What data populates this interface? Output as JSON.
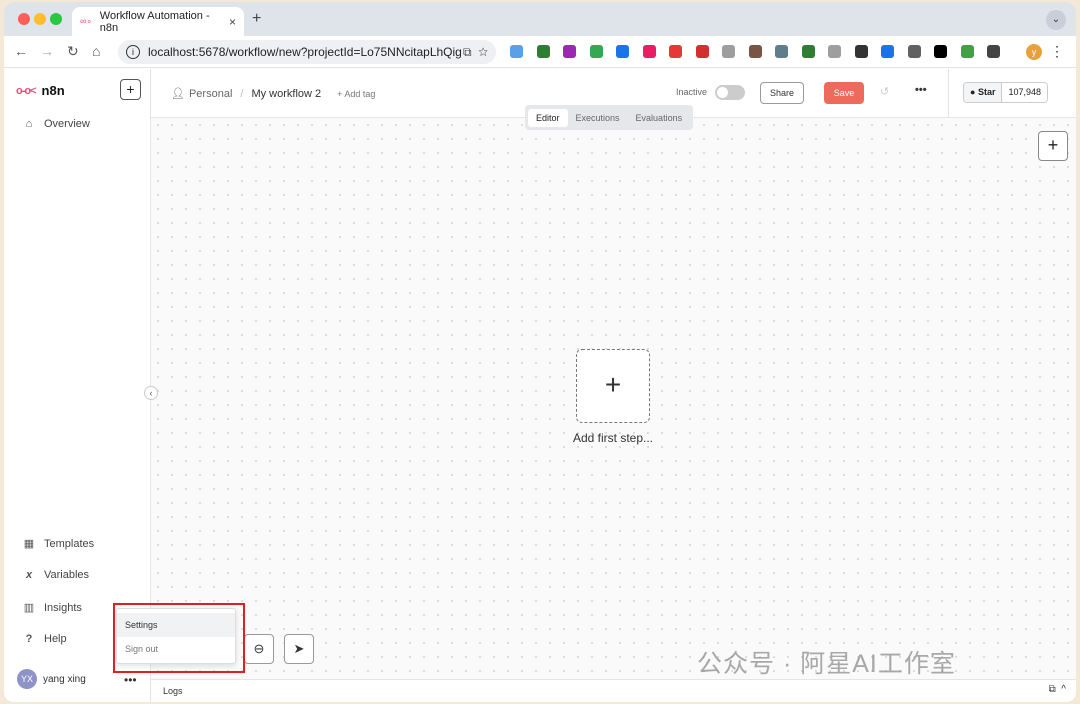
{
  "browser": {
    "tab_title": "Workflow Automation - n8n",
    "tab_close": "×",
    "new_tab": "+",
    "url": "localhost:5678/workflow/new?projectId=Lo75NNcitapLhQig",
    "profile_initial": "y",
    "extension_colors": [
      "#5aa0e8",
      "#2e7d32",
      "#9c27b0",
      "#34a853",
      "#1a73e8",
      "#e91e63",
      "#e53935",
      "#d32f2f",
      "#9e9e9e",
      "#795548",
      "#607d8b",
      "#2e7d32",
      "#9e9e9e",
      "#333333",
      "#1a73e8",
      "#616161",
      "#000000",
      "#43a047",
      "#444444"
    ]
  },
  "sidebar": {
    "logo_text": "n8n",
    "add_label": "+",
    "overview": "Overview",
    "templates": "Templates",
    "variables": "Variables",
    "insights": "Insights",
    "help": "Help",
    "collapse_glyph": "‹",
    "user_initials": "YX",
    "user_name": "yang xing",
    "more": "•••"
  },
  "header": {
    "project": "Personal",
    "separator": "/",
    "workflow_name": "My workflow 2",
    "add_tag": "+ Add tag",
    "status": "Inactive",
    "share": "Share",
    "save": "Save",
    "more": "•••",
    "github_star": "Star",
    "github_count": "107,948",
    "tabs": [
      "Editor",
      "Executions",
      "Evaluations"
    ],
    "active_tab": "Editor"
  },
  "canvas": {
    "add_node": "+",
    "first_step_plus": "+",
    "first_step_label": "Add first step...",
    "watermark": "公众号 · 阿星AI工作室"
  },
  "user_menu": {
    "items": [
      "Settings",
      "Sign out"
    ]
  },
  "logs": {
    "label": "Logs",
    "caret": "^"
  },
  "colors": {
    "brand": "#ea4b71",
    "save_button": "#ee6b5c",
    "highlight_box": "#e02020"
  }
}
